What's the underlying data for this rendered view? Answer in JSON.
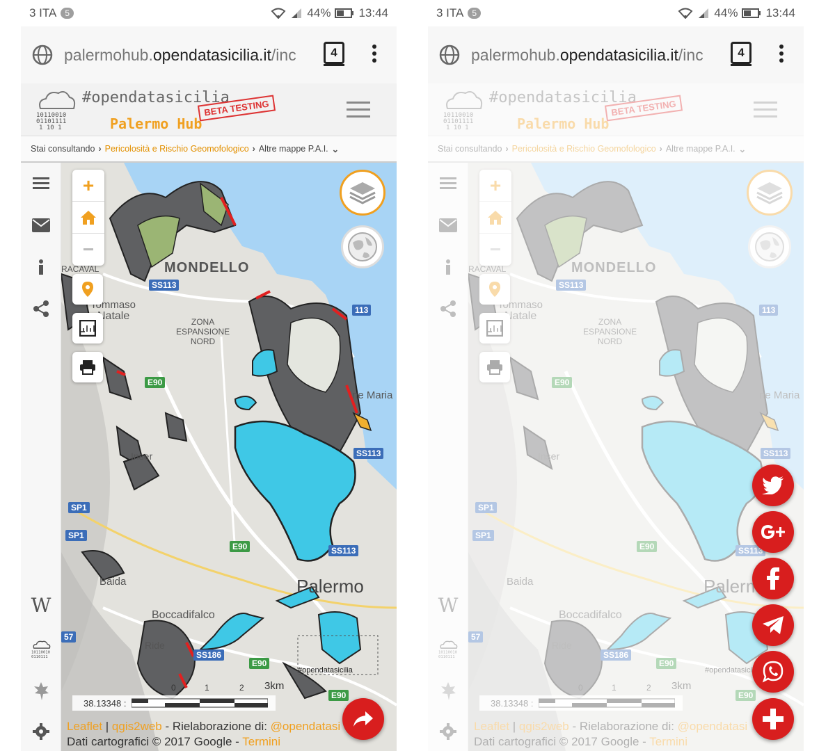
{
  "status": {
    "carrier": "3 ITA",
    "badge": "5",
    "battery": "44%",
    "time": "13:44"
  },
  "browser": {
    "url_prefix": "palermohub.",
    "url_domain": "opendatasicilia.it",
    "url_suffix": "/inc",
    "tab_count": "4"
  },
  "site": {
    "logo_hashtag": "#opendatasicilia",
    "logo_subtitle": "Palermo Hub",
    "beta_stamp": "BETA TESTING"
  },
  "breadcrumb": {
    "prefix": "Stai consultando",
    "current": "Pericolosità e Rischio Geomofologico",
    "more": "Altre mappe P.A.I."
  },
  "map": {
    "labels": {
      "mondello": "MONDELLO",
      "zona_1": "ZONA",
      "zona_2": "ESPANSIONE",
      "zona_3": "NORD",
      "palermo": "Palermo",
      "tommaso": "Tommaso",
      "natale": "Natale",
      "baida": "Baida",
      "boccadifalco": "Boccadifalco",
      "inser": "Inser",
      "vergine_maria": "ne Maria",
      "ridente": "Ride",
      "watermark": "#opendatasicilia",
      "racaval": "RACAVAL"
    },
    "shields": {
      "ss113_a": "SS113",
      "ss113_b": "113",
      "ss113_c": "SS113",
      "ss113_d": "SS113",
      "e90_a": "E90",
      "e90_b": "E90",
      "e90_c": "E90",
      "e90_d": "E90",
      "sp1": "SP1",
      "sp1b": "SP1",
      "ss186": "SS186",
      "n57": "57"
    },
    "scale_value": "38.13348 :",
    "scale_ticks": [
      "0",
      "1",
      "2",
      "3km"
    ],
    "attribution_leaflet": "Leaflet",
    "attribution_qgis": "qgis2web",
    "attribution_mid": " - Rielaborazione di: ",
    "attribution_handle": "@opendatasi",
    "attribution_line2": "Dati cartografici © 2017 Google - ",
    "attribution_terms": "Termini",
    "sep": " | "
  },
  "colors": {
    "accent": "#f0a020",
    "share_red": "#d81e1e",
    "water_blue": "#a8d4f5",
    "polygon_cyan": "#3fc8e6",
    "hazard_grey": "#5f6062",
    "hazard_red": "#e22020"
  },
  "social_buttons": [
    "twitter-icon",
    "google-plus-icon",
    "facebook-icon",
    "telegram-icon",
    "whatsapp-icon",
    "plus-icon"
  ]
}
